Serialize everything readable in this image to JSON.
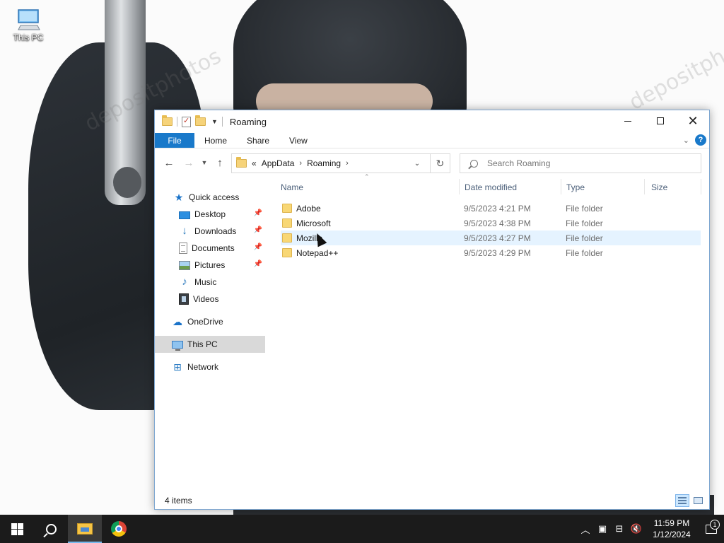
{
  "desktop": {
    "icons": [
      {
        "label": "This PC",
        "icon": "this-pc-icon"
      }
    ],
    "wallpaper_watermark": "depositphotos"
  },
  "window": {
    "title": "Roaming",
    "ribbon_tabs": [
      "File",
      "Home",
      "Share",
      "View"
    ],
    "help_label": "?",
    "address": {
      "overflow_marker": "«",
      "crumbs": [
        "AppData",
        "Roaming"
      ]
    },
    "search": {
      "placeholder": "Search Roaming"
    },
    "nav_pane": {
      "items": [
        {
          "label": "Quick access",
          "icon": "star-icon",
          "pinned": false
        },
        {
          "label": "Desktop",
          "icon": "desktop-icon",
          "pinned": true
        },
        {
          "label": "Downloads",
          "icon": "downloads-icon",
          "pinned": true
        },
        {
          "label": "Documents",
          "icon": "documents-icon",
          "pinned": true
        },
        {
          "label": "Pictures",
          "icon": "pictures-icon",
          "pinned": true
        },
        {
          "label": "Music",
          "icon": "music-icon",
          "pinned": false
        },
        {
          "label": "Videos",
          "icon": "videos-icon",
          "pinned": false
        },
        {
          "label": "OneDrive",
          "icon": "onedrive-icon",
          "pinned": false
        },
        {
          "label": "This PC",
          "icon": "this-pc-icon",
          "pinned": false,
          "selected": true
        },
        {
          "label": "Network",
          "icon": "network-icon",
          "pinned": false
        }
      ]
    },
    "columns": [
      "Name",
      "Date modified",
      "Type",
      "Size"
    ],
    "files": [
      {
        "name": "Adobe",
        "date_modified": "9/5/2023 4:21 PM",
        "type": "File folder",
        "size": ""
      },
      {
        "name": "Microsoft",
        "date_modified": "9/5/2023 4:38 PM",
        "type": "File folder",
        "size": ""
      },
      {
        "name": "Mozilla",
        "date_modified": "9/5/2023 4:27 PM",
        "type": "File folder",
        "size": "",
        "hovered": true
      },
      {
        "name": "Notepad++",
        "date_modified": "9/5/2023 4:29 PM",
        "type": "File folder",
        "size": ""
      }
    ],
    "status": {
      "item_count": "4 items"
    }
  },
  "taskbar": {
    "pinned": [
      "start-button",
      "search-button",
      "file-explorer",
      "google-chrome"
    ],
    "clock": {
      "time": "11:59 PM",
      "date": "1/12/2024"
    },
    "notification_count": "1"
  },
  "colors": {
    "accent": "#1979ca",
    "hover_row": "#e5f3ff",
    "selected_nav": "#d9d9d9",
    "taskbar": "#1b1b1b"
  }
}
